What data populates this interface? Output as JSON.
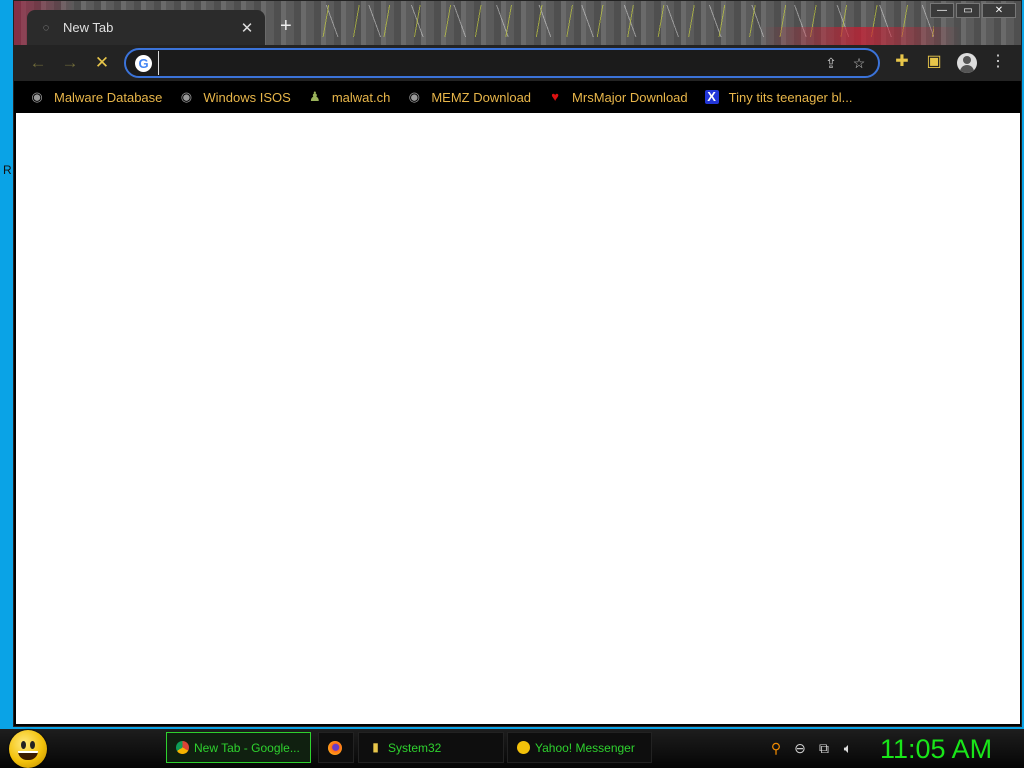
{
  "desktop": {
    "edge_letter": "R"
  },
  "browser": {
    "tab": {
      "title": "New Tab",
      "close_glyph": "✕",
      "icon": "tab-loading-icon"
    },
    "new_tab_glyph": "+",
    "window_controls": {
      "minimize": "—",
      "maximize": "▭",
      "close": "✕"
    },
    "toolbar": {
      "back_glyph": "←",
      "forward_glyph": "→",
      "stop_glyph": "✕",
      "address": {
        "value": "",
        "placeholder": ""
      },
      "share_glyph": "⇪",
      "star_glyph": "☆",
      "extensions_glyph": "✚",
      "sidepanel_glyph": "▣",
      "menu_glyph": "⋮"
    },
    "bookmarks": [
      {
        "label": "Malware Database",
        "icon": "globe-icon"
      },
      {
        "label": "Windows ISOS",
        "icon": "globe-icon"
      },
      {
        "label": "malwat.ch",
        "icon": "person-icon"
      },
      {
        "label": "MEMZ Download",
        "icon": "globe-icon"
      },
      {
        "label": "MrsMajor Download",
        "icon": "heart-icon"
      },
      {
        "label": "Tiny tits teenager bl...",
        "icon": "x-icon"
      }
    ]
  },
  "taskbar": {
    "tasks": [
      {
        "label": "New Tab - Google...",
        "icon": "chrome-icon",
        "active": true
      },
      {
        "label": "",
        "icon": "firefox-icon",
        "active": false
      },
      {
        "label": "System32",
        "icon": "folder-icon",
        "active": false
      },
      {
        "label": "Yahoo! Messenger",
        "icon": "yahoo-smiley-icon",
        "active": false
      }
    ],
    "clock": "11:05 AM"
  },
  "colors": {
    "desktop": "#0aa3e6",
    "bookmark_text": "#e8b64a",
    "taskbar_text": "#2ed12e",
    "clock": "#19e519",
    "omnibox_border": "#3b73d9"
  }
}
